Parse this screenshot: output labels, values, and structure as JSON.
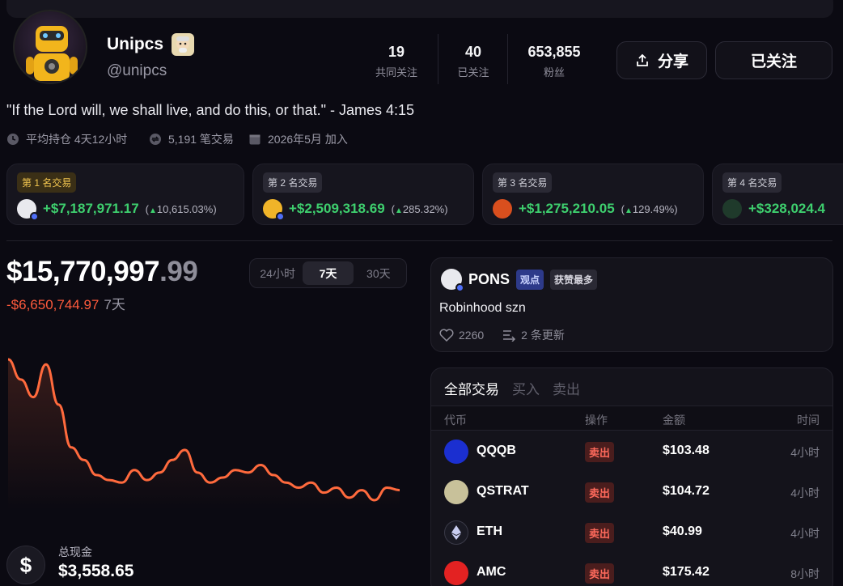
{
  "profile": {
    "name": "Unipcs",
    "handle": "@unipcs",
    "quote": "\"If the Lord will, we shall live, and do this, or that.\" - James 4:15",
    "meta": {
      "avg_hold": "平均持仓 4天12小时",
      "trades": "5,191 笔交易",
      "joined": "2026年5月 加入"
    }
  },
  "stats": [
    {
      "num": "19",
      "label": "共同关注"
    },
    {
      "num": "40",
      "label": "已关注"
    },
    {
      "num": "653,855",
      "label": "粉丝"
    }
  ],
  "buttons": {
    "share": "分享",
    "follow": "已关注"
  },
  "top_trades": [
    {
      "rank": "第 1 名交易",
      "gain": "+$7,187,971.17",
      "pct": "10,615.03%",
      "logo_color": "#e9e9ee"
    },
    {
      "rank": "第 2 名交易",
      "gain": "+$2,509,318.69",
      "pct": "285.32%",
      "logo_color": "#f0b429"
    },
    {
      "rank": "第 3 名交易",
      "gain": "+$1,275,210.05",
      "pct": "129.49%",
      "logo_color": "#d94f1e"
    },
    {
      "rank": "第 4 名交易",
      "gain": "+$328,024.4",
      "pct": "",
      "logo_color": "#1f3a2b"
    }
  ],
  "portfolio": {
    "value_main": "$15,770,997",
    "value_dec": ".99",
    "change": "-$6,650,744.97",
    "period": "7天",
    "tabs": [
      "24小时",
      "7天",
      "30天"
    ],
    "active_tab": 1,
    "cash_label": "总现金",
    "cash_value": "$3,558.65",
    "cash_icon": "$"
  },
  "chart_data": {
    "type": "line",
    "title": "",
    "color": "#ff6a3d",
    "values": [
      100,
      92,
      85,
      98,
      82,
      65,
      60,
      54,
      52,
      51,
      56,
      52,
      55,
      60,
      64,
      55,
      51,
      53,
      56,
      55,
      58,
      54,
      51,
      49,
      51,
      47,
      49,
      45,
      48,
      44,
      49,
      48
    ]
  },
  "post": {
    "ticker": "PONS",
    "tag1": "观点",
    "tag2": "获赞最多",
    "body": "Robinhood szn",
    "likes": "2260",
    "updates": "2 条更新"
  },
  "trades": {
    "tabs": [
      "全部交易",
      "买入",
      "卖出"
    ],
    "headers": [
      "代币",
      "操作",
      "金额",
      "时间"
    ],
    "rows": [
      {
        "symbol": "QQQB",
        "action": "卖出",
        "amount": "$103.48",
        "time": "4小时",
        "logo_color": "#1b2fd0"
      },
      {
        "symbol": "QSTRAT",
        "action": "卖出",
        "amount": "$104.72",
        "time": "4小时",
        "logo_color": "#c8c19a"
      },
      {
        "symbol": "ETH",
        "action": "卖出",
        "amount": "$40.99",
        "time": "4小时",
        "logo_color": "#1a1a24"
      },
      {
        "symbol": "AMC",
        "action": "卖出",
        "amount": "$175.42",
        "time": "8小时",
        "logo_color": "#e32222"
      }
    ]
  }
}
